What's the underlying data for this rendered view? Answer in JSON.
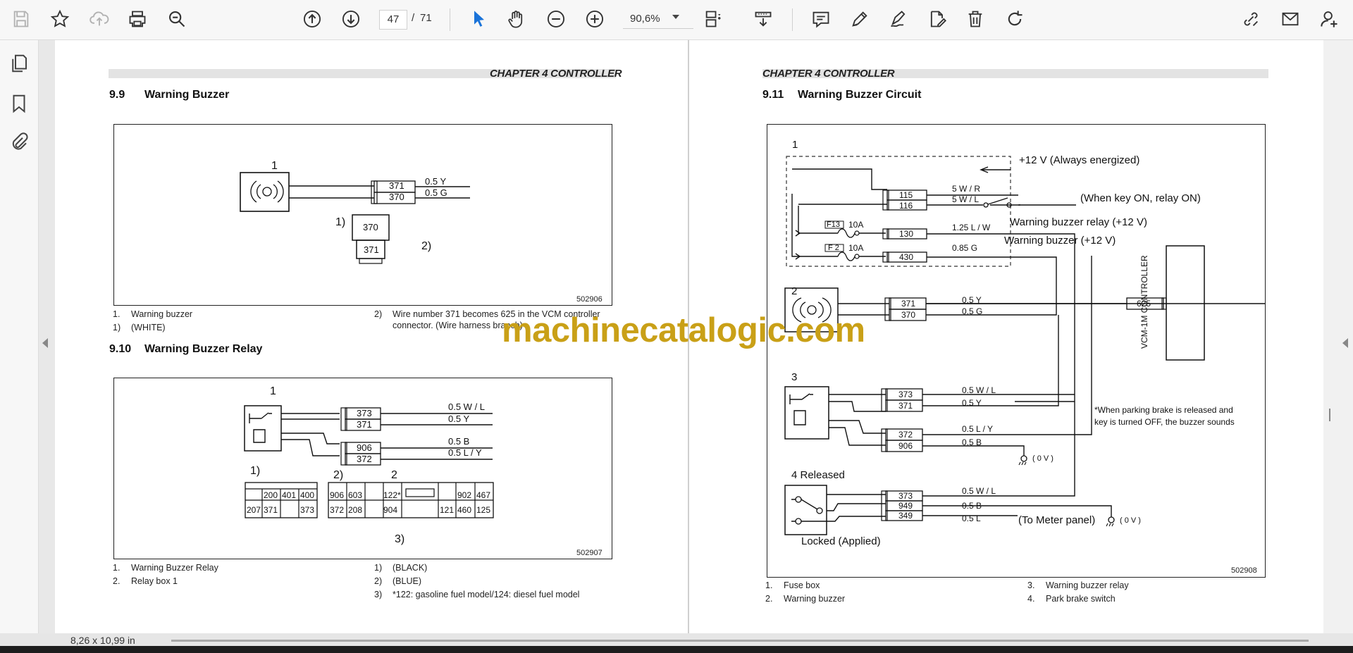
{
  "toolbar": {
    "current_page": "47",
    "page_separator": "/",
    "total_pages": "71",
    "zoom": "90,6%",
    "icons": [
      "save-icon",
      "star-icon",
      "cloud-upload-icon",
      "print-icon",
      "zoom-search-icon",
      "page-up-icon",
      "page-down-icon",
      "select-cursor-icon",
      "hand-icon",
      "zoom-out-icon",
      "zoom-in-icon",
      "fit-page-icon",
      "scroll-mode-icon",
      "comment-icon",
      "pen-icon",
      "sign-icon",
      "edit-document-icon",
      "delete-icon",
      "rotate-icon",
      "share-link-icon",
      "email-icon",
      "add-user-icon"
    ]
  },
  "sidebar": {
    "icons": [
      "pages-icon",
      "bookmark-icon",
      "attachment-icon"
    ]
  },
  "status": {
    "page_size": "8,26 x 10,99 in"
  },
  "watermark": "machinecatalogic.com",
  "left_page": {
    "chapter": "CHAPTER 4 CONTROLLER",
    "sec99": {
      "num": "9.9",
      "title": "Warning Buzzer",
      "fig": {
        "label1": "1",
        "wire_top": "371",
        "wire_bot": "370",
        "spec_top": "0.5  Y",
        "spec_bot": "0.5  G",
        "conn_label": "1)",
        "conn_top": "370",
        "conn_bot": "371",
        "label2": "2)",
        "figno": "502906"
      },
      "legend": {
        "l1k": "1.",
        "l1": "Warning buzzer",
        "l2k": "1)",
        "l2": "(WHITE)",
        "r1k": "2)",
        "r1a": "Wire number 371 becomes 625 in the VCM controller",
        "r1b": "connector. (Wire harness branch)"
      }
    },
    "sec910": {
      "num": "9.10",
      "title": "Warning Buzzer Relay",
      "fig": {
        "label1": "1",
        "w1": "373",
        "w2": "371",
        "w3": "906",
        "w4": "372",
        "s1": "0.5  W / L",
        "s2": "0.5  Y",
        "s3": "0.5  B",
        "s4": "0.5  L / Y",
        "lbl_1p": "1)",
        "lbl_2p": "2)",
        "lbl_2": "2",
        "lbl_3p": "3)",
        "tbl1_top": [
          "",
          "200",
          "401",
          "400"
        ],
        "tbl1_bot": [
          "207",
          "371",
          "",
          "373"
        ],
        "tbl2_top": [
          "906",
          "603",
          "",
          "122*",
          "",
          "",
          "902",
          "467"
        ],
        "tbl2_bot": [
          "372",
          "208",
          "",
          "904",
          "",
          "121",
          "460",
          "125"
        ],
        "figno": "502907"
      },
      "legend": {
        "l1k": "1.",
        "l1": "Warning Buzzer Relay",
        "l2k": "2.",
        "l2": "Relay box 1",
        "r1k": "1)",
        "r1": "(BLACK)",
        "r2k": "2)",
        "r2": "(BLUE)",
        "r3k": "3)",
        "r3": "*122: gasoline fuel model/124: diesel fuel model"
      }
    }
  },
  "right_page": {
    "chapter": "CHAPTER 4 CONTROLLER",
    "sec911": {
      "num": "9.11",
      "title": "Warning Buzzer Circuit",
      "fig": {
        "n1": "1",
        "always": "+12 V (Always energized)",
        "w115": "115",
        "w116": "116",
        "s115": "5 W / R",
        "s116": "5 W / L",
        "keyon": "(When key ON, relay ON)",
        "f13": "F13",
        "f2": "F 2",
        "a10a": "10A",
        "a10b": "10A",
        "w130": "130",
        "w430": "430",
        "s130": "1.25   L / W",
        "s430": "0.85  G",
        "relay12": "Warning buzzer relay (+12 V)",
        "buzz12": "Warning buzzer (+12 V)",
        "n2": "2",
        "w371": "371",
        "w370": "370",
        "s371": "0.5   Y",
        "s370": "0.5  G",
        "w625": "625",
        "vcm": "VCM-1M CONTROLLER",
        "n3": "3",
        "w373a": "373",
        "w371b": "371",
        "s373a": "0.5  W / L",
        "s371b": "0.5   Y",
        "w372": "372",
        "w906": "906",
        "s372": "0.5   L / Y",
        "s906": "0.5  B",
        "gnd1": "( 0 V )",
        "note1": "*When parking brake is released and",
        "note2": "key is turned OFF, the buzzer sounds",
        "n4": "4  Released",
        "w373b": "373",
        "w949": "949",
        "w349": "349",
        "s373b": "0.5  W / L",
        "s949": "0.5  B",
        "s349": "0.5  L",
        "meter": "(To Meter panel)",
        "gnd2": "( 0 V )",
        "locked": "Locked (Applied)",
        "figno": "502908"
      },
      "legend": {
        "l1k": "1.",
        "l1": "Fuse box",
        "l2k": "2.",
        "l2": "Warning buzzer",
        "r1k": "3.",
        "r1": "Warning buzzer relay",
        "r2k": "4.",
        "r2": "Park brake switch"
      }
    }
  }
}
